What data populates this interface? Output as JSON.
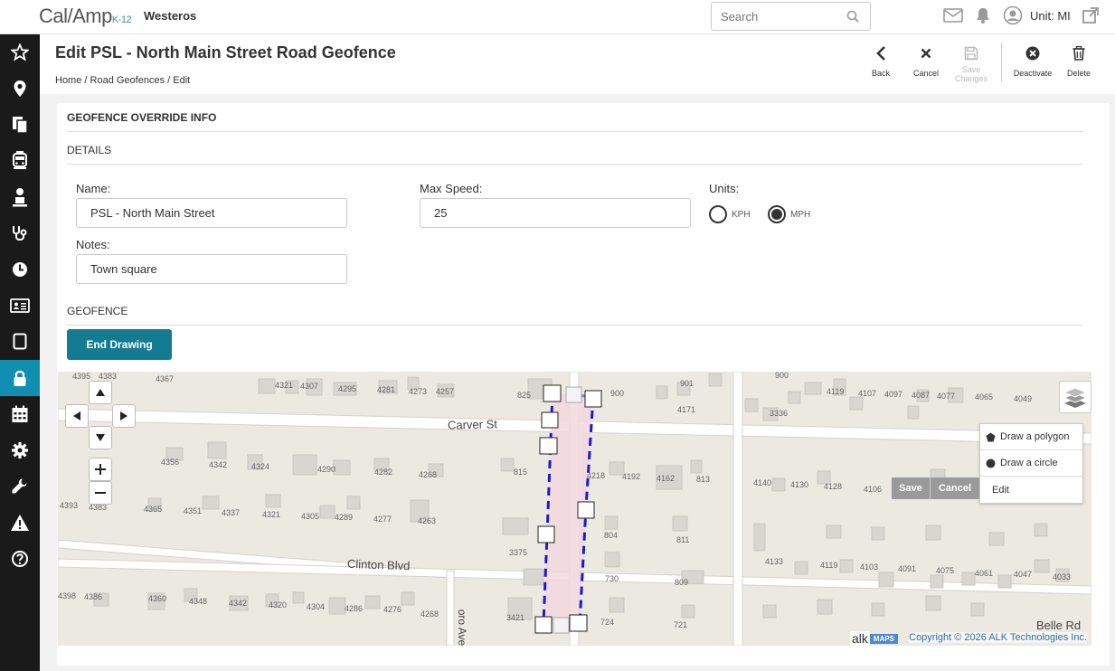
{
  "brand": {
    "logo_main": "Cal/Amp",
    "logo_sub": "K-12",
    "district": "Westeros"
  },
  "search": {
    "placeholder": "Search"
  },
  "user": {
    "unit_label": "Unit: MI"
  },
  "sidebar": {
    "items": [
      "star-icon",
      "location-pin-icon",
      "documents-icon",
      "bus-icon",
      "student-icon",
      "stethoscope-icon",
      "clock-icon",
      "id-card-icon",
      "tablet-icon",
      "lock-icon",
      "calendar-icon",
      "gear-icon",
      "wrench-icon",
      "warning-icon",
      "help-icon"
    ],
    "active_index": 9
  },
  "page": {
    "title": "Edit PSL - North Main Street Road Geofence",
    "breadcrumb": [
      "Home",
      "/ Road Geofences",
      "/ Edit"
    ]
  },
  "toolbar": {
    "back": "Back",
    "cancel": "Cancel",
    "save_line1": "Save",
    "save_line2": "Changes",
    "deactivate": "Deactivate",
    "delete": "Delete"
  },
  "form": {
    "section_title": "GEOFENCE OVERRIDE INFO",
    "details_title": "DETAILS",
    "name_label": "Name:",
    "name_value": "PSL - North Main Street",
    "max_speed_label": "Max Speed:",
    "max_speed_value": "25",
    "units_label": "Units:",
    "unit_kph": "KPH",
    "unit_mph": "MPH",
    "selected_unit": "MPH",
    "notes_label": "Notes:",
    "notes_value": "Town square",
    "geofence_title": "GEOFENCE",
    "end_drawing": "End Drawing"
  },
  "map": {
    "draw_polygon": "Draw a polygon",
    "draw_circle": "Draw a circle",
    "edit": "Edit",
    "save": "Save",
    "cancel": "Cancel",
    "streets": {
      "carver": "Carver St",
      "clinton": "Clinton Blvd",
      "belle": "Belle Rd",
      "oro": "oro Ave"
    },
    "copyright": "Copyright © 2026 ALK Technologies Inc.",
    "maps_badge": "MAPS",
    "alk": "alk",
    "numbers": {
      "n4395": "4395",
      "n4383a": "4383",
      "n4367": "4367",
      "n4321a": "4321",
      "n4307": "4307",
      "n4295": "4295",
      "n4281": "4281",
      "n4273": "4273",
      "n4257": "4257",
      "n825": "825",
      "n900a": "900",
      "n901": "901",
      "n4171": "4171",
      "n900b": "900",
      "n4119a": "4119",
      "n4107": "4107",
      "n4097": "4097",
      "n4087": "4087",
      "n4077": "4077",
      "n4065": "4065",
      "n4049": "4049",
      "n3336": "3336",
      "n4356": "4356",
      "n4342a": "4342",
      "n4324": "4324",
      "n4290": "4290",
      "n4282": "4282",
      "n4268a": "4268",
      "n815": "815",
      "n4218": "4218",
      "n4192": "4192",
      "n4162": "4162",
      "n813": "813",
      "n4140": "4140",
      "n4130": "4130",
      "n4128": "4128",
      "n4106": "4106",
      "n4393": "4393",
      "n4383b": "4383",
      "n4365": "4365",
      "n4351": "4351",
      "n4337": "4337",
      "n4321b": "4321",
      "n4305": "4305",
      "n4289": "4289",
      "n4277": "4277",
      "n4263": "4263",
      "n804": "804",
      "n811": "811",
      "n3375": "3375",
      "n4133": "4133",
      "n4119b": "4119",
      "n4103": "4103",
      "n4091": "4091",
      "n4075": "4075",
      "n4061": "4061",
      "n4047": "4047",
      "n4033": "4033",
      "n730": "730",
      "n809": "809",
      "n4398": "4398",
      "n4386": "4386",
      "n4360": "4360",
      "n4348": "4348",
      "n4342b": "4342",
      "n4320": "4320",
      "n4304": "4304",
      "n4286": "4286",
      "n4276": "4276",
      "n4268b": "4268",
      "n3421": "3421",
      "n724": "724",
      "n721": "721"
    }
  }
}
